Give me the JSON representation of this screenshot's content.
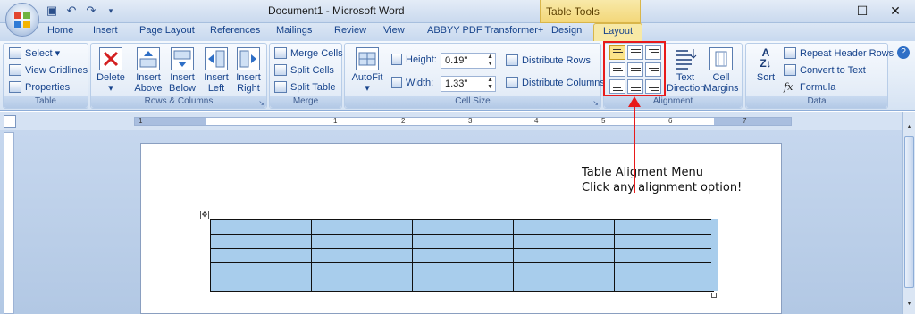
{
  "window": {
    "title": "Document1 - Microsoft Word",
    "context_tab": "Table Tools",
    "minimize": "—",
    "maximize": "☐",
    "close": "✕"
  },
  "qat": {
    "save_icon": "save-icon",
    "undo_icon": "undo-icon",
    "redo_icon": "redo-icon"
  },
  "tabs": [
    {
      "label": "Home"
    },
    {
      "label": "Insert"
    },
    {
      "label": "Page Layout"
    },
    {
      "label": "References"
    },
    {
      "label": "Mailings"
    },
    {
      "label": "Review"
    },
    {
      "label": "View"
    },
    {
      "label": "ABBYY PDF Transformer+"
    },
    {
      "label": "Design"
    },
    {
      "label": "Layout"
    }
  ],
  "ribbon": {
    "table": {
      "label": "Table",
      "select": "Select ▾",
      "view_gridlines": "View Gridlines",
      "properties": "Properties"
    },
    "rows_columns": {
      "label": "Rows & Columns",
      "delete": "Delete",
      "delete_arrow": "▾",
      "insert_above": [
        "Insert",
        "Above"
      ],
      "insert_below": [
        "Insert",
        "Below"
      ],
      "insert_left": [
        "Insert",
        "Left"
      ],
      "insert_right": [
        "Insert",
        "Right"
      ]
    },
    "merge": {
      "label": "Merge",
      "merge_cells": "Merge Cells",
      "split_cells": "Split Cells",
      "split_table": "Split Table"
    },
    "cell_size": {
      "label": "Cell Size",
      "autofit": "AutoFit",
      "autofit_arrow": "▾",
      "height_label": "Height:",
      "height_value": "0.19\"",
      "width_label": "Width:",
      "width_value": "1.33\"",
      "distribute_rows": "Distribute Rows",
      "distribute_columns": "Distribute Columns"
    },
    "alignment": {
      "label": "Alignment",
      "text_direction": [
        "Text",
        "Direction"
      ],
      "cell_margins": [
        "Cell",
        "Margins"
      ]
    },
    "data": {
      "label": "Data",
      "sort": "Sort",
      "repeat_header_rows": "Repeat Header Rows",
      "convert_to_text": "Convert to Text",
      "formula": "Formula"
    }
  },
  "ruler": {
    "marks": [
      "1",
      "1",
      "2",
      "3",
      "4",
      "5",
      "6",
      "7"
    ]
  },
  "annotation": {
    "line1": "Table Aligment Menu",
    "line2": "Click any alignment option!"
  },
  "table": {
    "rows": 5,
    "cols": 5
  }
}
